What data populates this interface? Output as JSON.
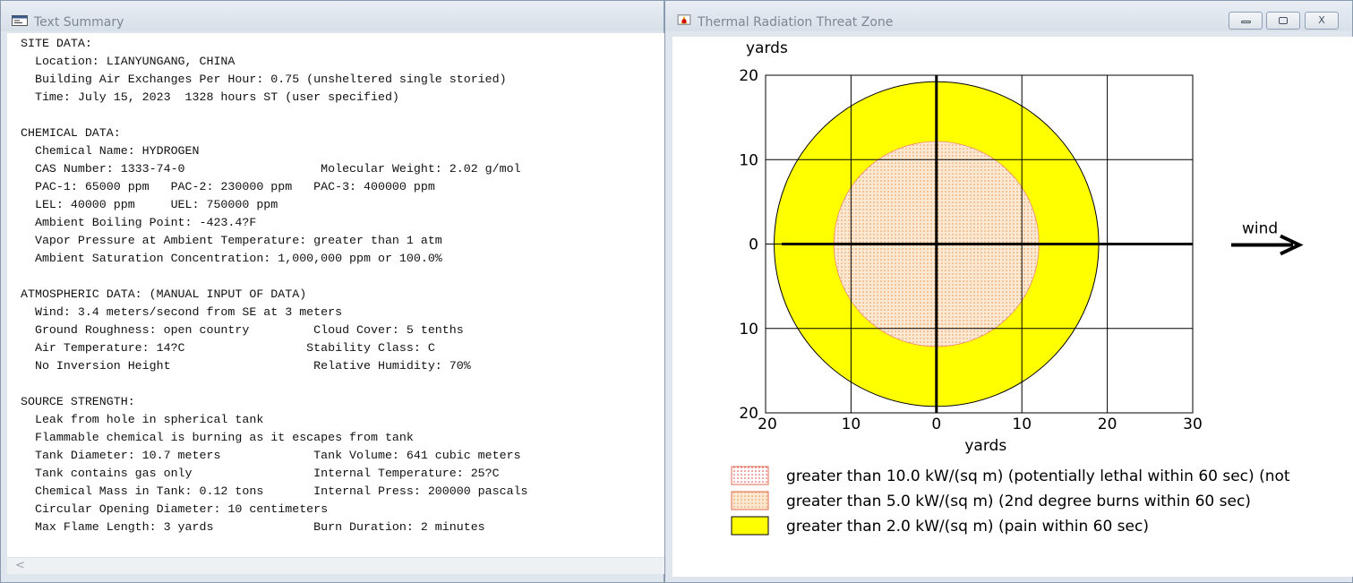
{
  "left_window": {
    "title": "Text Summary",
    "report_lines": [
      "SITE DATA:",
      "  Location: LIANYUNGANG, CHINA",
      "  Building Air Exchanges Per Hour: 0.75 (unsheltered single storied)",
      "  Time: July 15, 2023  1328 hours ST (user specified)",
      "",
      "CHEMICAL DATA:",
      "  Chemical Name: HYDROGEN",
      "  CAS Number: 1333-74-0                   Molecular Weight: 2.02 g/mol",
      "  PAC-1: 65000 ppm   PAC-2: 230000 ppm   PAC-3: 400000 ppm",
      "  LEL: 40000 ppm     UEL: 750000 ppm",
      "  Ambient Boiling Point: -423.4?F",
      "  Vapor Pressure at Ambient Temperature: greater than 1 atm",
      "  Ambient Saturation Concentration: 1,000,000 ppm or 100.0%",
      "",
      "ATMOSPHERIC DATA: (MANUAL INPUT OF DATA)",
      "  Wind: 3.4 meters/second from SE at 3 meters",
      "  Ground Roughness: open country         Cloud Cover: 5 tenths",
      "  Air Temperature: 14?C                 Stability Class: C",
      "  No Inversion Height                    Relative Humidity: 70%",
      "",
      "SOURCE STRENGTH:",
      "  Leak from hole in spherical tank",
      "  Flammable chemical is burning as it escapes from tank",
      "  Tank Diameter: 10.7 meters             Tank Volume: 641 cubic meters",
      "  Tank contains gas only                 Internal Temperature: 25?C",
      "  Chemical Mass in Tank: 0.12 tons       Internal Press: 200000 pascals",
      "  Circular Opening Diameter: 10 centimeters",
      "  Max Flame Length: 3 yards              Burn Duration: 2 minutes"
    ],
    "scroll_left_glyph": "<"
  },
  "right_window": {
    "title": "Thermal Radiation Threat Zone",
    "controls": {
      "minimize": "minimize",
      "restore": "restore",
      "close": "X"
    }
  },
  "chart_data": {
    "type": "threat-zone-plot",
    "title": "",
    "ylabel": "yards",
    "xlabel": "yards",
    "xlim": [
      -20,
      30
    ],
    "ylim": [
      -20,
      20
    ],
    "x_ticks": [
      -20,
      -10,
      0,
      10,
      20,
      30
    ],
    "x_tick_labels": [
      "20",
      "10",
      "0",
      "10",
      "20",
      "30"
    ],
    "y_ticks": [
      20,
      10,
      0,
      -10,
      -20
    ],
    "y_tick_labels": [
      "20",
      "10",
      "0",
      "10",
      "20"
    ],
    "grid": true,
    "wind_label": "wind",
    "wind_direction": "right",
    "zones": [
      {
        "label": "greater than 2.0 kW/(sq m) (pain within 60 sec)",
        "radius_yards": 19,
        "color": "#ffff00",
        "pattern": "solid"
      },
      {
        "label": "greater than 5.0 kW/(sq m) (2nd degree burns within 60 sec)",
        "radius_yards": 12,
        "color": "#f6dcc0",
        "pattern": "dotted-orange"
      },
      {
        "label": "greater than 10.0 kW/(sq m) (potentially lethal within 60 sec) (not",
        "radius_yards": null,
        "color": "#ffffff",
        "pattern": "dotted-red"
      }
    ],
    "legend_order": [
      2,
      1,
      0
    ]
  }
}
